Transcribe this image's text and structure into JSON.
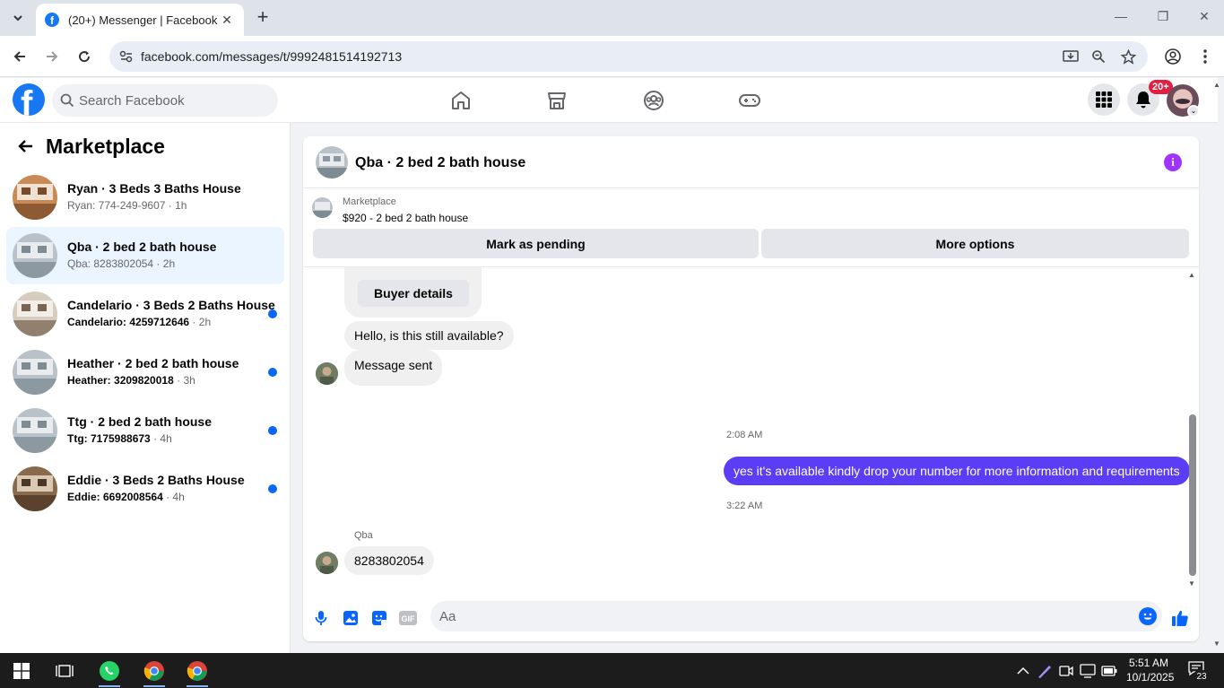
{
  "browser": {
    "tab_title": "(20+) Messenger | Facebook",
    "url": "facebook.com/messages/t/9992481514192713",
    "new_tab_symbol": "+",
    "close_tab_symbol": "✕"
  },
  "fb_header": {
    "logo_letter": "f",
    "search_placeholder": "Search Facebook",
    "notification_badge": "20+",
    "nav_icons": [
      "home-icon",
      "marketplace-icon",
      "groups-icon",
      "gaming-icon"
    ]
  },
  "left_panel": {
    "title": "Marketplace",
    "conversations": [
      {
        "name": "Ryan · 3 Beds 3 Baths House",
        "preview": "Ryan: 774-249-9607",
        "time": "1h",
        "unread": false,
        "active": false
      },
      {
        "name": "Qba · 2 bed 2 bath house",
        "preview": "Qba: 8283802054",
        "time": "2h",
        "unread": false,
        "active": true
      },
      {
        "name": "Candelario · 3 Beds 2 Baths House",
        "preview": "Candelario: 4259712646",
        "time": "2h",
        "unread": true,
        "active": false
      },
      {
        "name": "Heather · 2 bed 2 bath house",
        "preview": "Heather: 3209820018",
        "time": "3h",
        "unread": true,
        "active": false
      },
      {
        "name": "Ttg · 2 bed 2 bath house",
        "preview": "Ttg: 7175988673",
        "time": "4h",
        "unread": true,
        "active": false
      },
      {
        "name": "Eddie · 3 Beds 2 Baths House",
        "preview": "Eddie: 6692008564",
        "time": "4h",
        "unread": true,
        "active": false
      }
    ]
  },
  "chat": {
    "title": "Qba · 2 bed 2 bath house",
    "listing_kicker": "Marketplace",
    "listing_title": "$920 - 2 bed 2 bath house",
    "mark_pending_label": "Mark as pending",
    "more_options_label": "More options",
    "buyer_details_label": "Buyer details",
    "messages": {
      "incoming_1": "Hello, is this still available?",
      "incoming_2": "Message sent",
      "timestamp_1": "2:08 AM",
      "outgoing_1": "yes it's available kindly drop your number for more information and requirements",
      "timestamp_2": "3:22 AM",
      "sender_label": "Qba",
      "incoming_3": "8283802054"
    },
    "composer_placeholder": "Aa",
    "composer_icons": [
      "microphone-icon",
      "photo-icon",
      "sticker-icon",
      "gif-icon",
      "emoji-icon",
      "thumbs-up-icon"
    ]
  },
  "taskbar": {
    "time": "5:51 AM",
    "date": "10/1/2025",
    "notification_count": "23"
  },
  "colors": {
    "facebook_blue": "#1877f2",
    "outgoing_bubble": "#5b3df6",
    "unread_dot": "#0866ff",
    "badge_red": "#e41e3f"
  }
}
